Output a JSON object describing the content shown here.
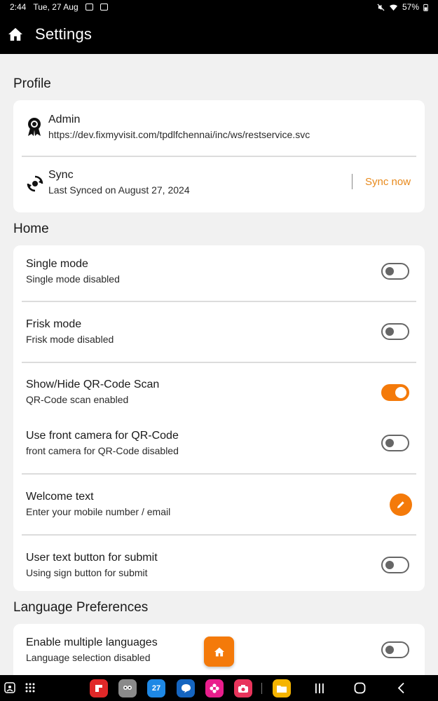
{
  "status_bar": {
    "time": "2:44",
    "date": "Tue, 27 Aug",
    "battery": "57%"
  },
  "app_bar": {
    "title": "Settings"
  },
  "profile": {
    "section_title": "Profile",
    "user": {
      "name": "Admin",
      "url": "https://dev.fixmyvisit.com/tpdlfchennai/inc/ws/restservice.svc"
    },
    "sync": {
      "title": "Sync",
      "subtitle": "Last Synced on August 27, 2024",
      "action": "Sync now"
    }
  },
  "home": {
    "section_title": "Home",
    "items": [
      {
        "title": "Single mode",
        "subtitle": "Single mode disabled",
        "enabled": false
      },
      {
        "title": "Frisk mode",
        "subtitle": "Frisk mode disabled",
        "enabled": false
      },
      {
        "title": "Show/Hide QR-Code Scan",
        "subtitle": "QR-Code scan enabled",
        "enabled": true
      },
      {
        "title": "Use front camera for QR-Code",
        "subtitle": "front camera for QR-Code disabled",
        "enabled": false
      },
      {
        "title": "Welcome text",
        "subtitle": "Enter your mobile number / email",
        "control": "edit"
      },
      {
        "title": "User text button for submit",
        "subtitle": "Using sign button for submit",
        "enabled": false
      }
    ]
  },
  "language": {
    "section_title": "Language Preferences",
    "items": [
      {
        "title": "Enable multiple languages",
        "subtitle": "Language selection disabled",
        "enabled": false
      }
    ]
  },
  "nav_bar": {
    "apps": [
      {
        "name": "flipboard-icon",
        "color": "#e12828"
      },
      {
        "name": "finder-icon",
        "color": "#8a8a8a"
      },
      {
        "name": "calendar-icon",
        "color": "#1e88e5",
        "label": "27"
      },
      {
        "name": "messages-icon",
        "color": "#1565c0"
      },
      {
        "name": "blossom-icon",
        "color": "#e91e8c"
      },
      {
        "name": "camera-icon",
        "color": "#e8345b"
      },
      {
        "name": "files-icon",
        "color": "#f5b400"
      }
    ]
  },
  "colors": {
    "accent": "#f47a0a",
    "sync_link": "#e8891b",
    "background": "#f1f1f1",
    "bars": "#000000"
  }
}
